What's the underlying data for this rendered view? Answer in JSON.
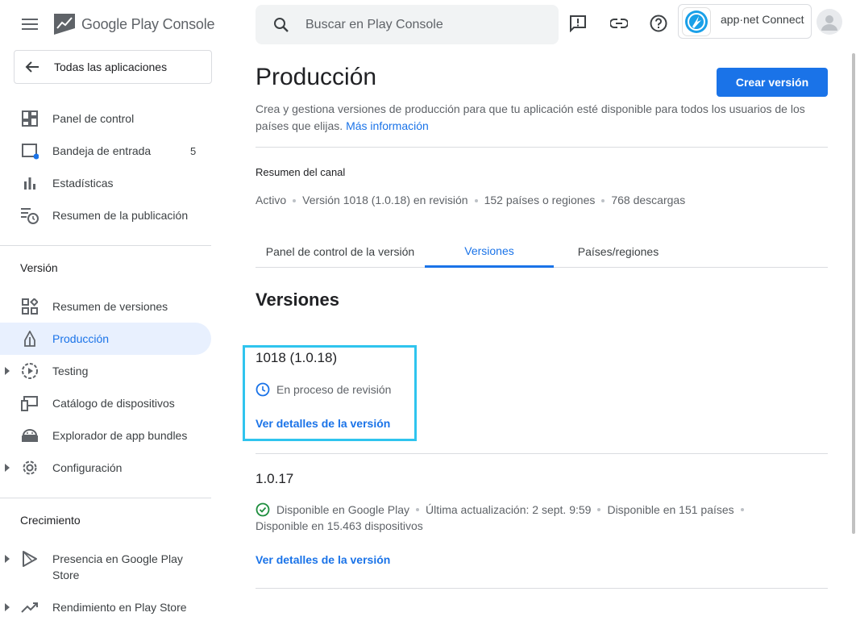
{
  "header": {
    "logo_text": "Google Play Console",
    "search_placeholder": "Buscar en Play Console",
    "account_name": "app·net Connect"
  },
  "sidebar": {
    "back_label": "Todas las aplicaciones",
    "items_top": [
      {
        "label": "Panel de control",
        "icon": "dashboard-icon"
      },
      {
        "label": "Bandeja de entrada",
        "icon": "inbox-icon",
        "count": "5"
      },
      {
        "label": "Estadísticas",
        "icon": "stats-icon"
      },
      {
        "label": "Resumen de la publicación",
        "icon": "publishing-overview-icon"
      }
    ],
    "section_version": "Versión",
    "items_version": [
      {
        "label": "Resumen de versiones",
        "icon": "releases-overview-icon"
      },
      {
        "label": "Producción",
        "icon": "production-icon"
      },
      {
        "label": "Testing",
        "icon": "testing-icon"
      },
      {
        "label": "Catálogo de dispositivos",
        "icon": "devices-icon"
      },
      {
        "label": "Explorador de app bundles",
        "icon": "android-icon"
      },
      {
        "label": "Configuración",
        "icon": "gear-icon"
      }
    ],
    "section_growth": "Crecimiento",
    "items_growth": [
      {
        "label_line1": "Presencia en Google Play",
        "label_line2": "Store",
        "icon": "play-store-icon"
      },
      {
        "label": "Rendimiento en Play Store",
        "icon": "trending-icon"
      }
    ]
  },
  "main": {
    "title": "Producción",
    "create_button": "Crear versión",
    "description": "Crea y gestiona versiones de producción para que tu aplicación esté disponible para todos los usuarios de los países que elijas.",
    "more_info": "Más información",
    "summary_title": "Resumen del canal",
    "summary": [
      "Activo",
      "Versión 1018 (1.0.18) en revisión",
      "152 países o regiones",
      "768 descargas"
    ],
    "tabs": [
      "Panel de control de la versión",
      "Versiones",
      "Países/regiones"
    ],
    "versions_title": "Versiones",
    "releases": [
      {
        "name": "1018 (1.0.18)",
        "status": "En proceso de revisión",
        "link": "Ver detalles de la versión"
      },
      {
        "name": "1.0.17",
        "status": "Disponible en Google Play",
        "updated": "Última actualización: 2 sept. 9:59",
        "countries": "Disponible en 151 países",
        "devices": "Disponible en 15.463 dispositivos",
        "link": "Ver detalles de la versión"
      }
    ]
  },
  "colors": {
    "accent": "#1a73e8",
    "highlight_box": "#2fc4ee",
    "success": "#1e8e3e"
  }
}
